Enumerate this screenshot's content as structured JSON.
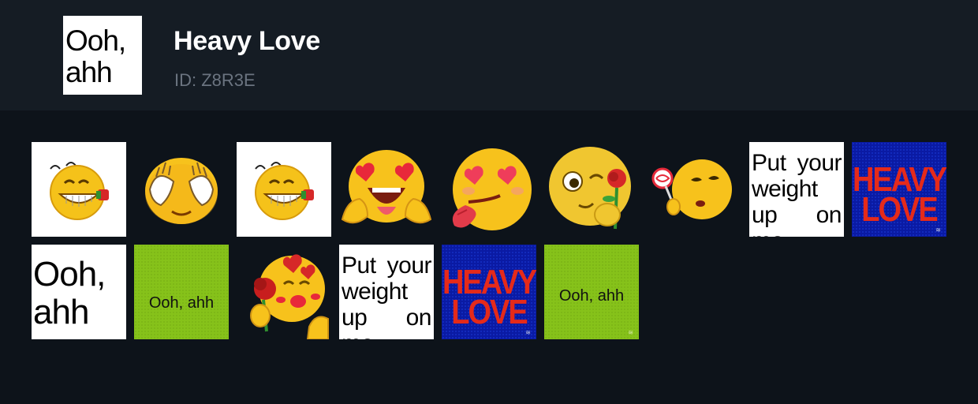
{
  "pack": {
    "title": "Heavy Love",
    "id_text": "ID: Z8R3E",
    "cover_text": "Ooh, ahh"
  },
  "stickers": [
    {
      "kind": "emoji",
      "art": "grin-holding-rose"
    },
    {
      "kind": "emoji",
      "art": "face-covering-eyes-hands"
    },
    {
      "kind": "emoji",
      "art": "grin-holding-rose"
    },
    {
      "kind": "emoji",
      "art": "heart-eyes-tongue-hands"
    },
    {
      "kind": "emoji",
      "art": "heart-eyes-tongue-out"
    },
    {
      "kind": "emoji",
      "art": "wink-holding-rose"
    },
    {
      "kind": "emoji",
      "art": "lollipop-face"
    },
    {
      "kind": "text",
      "text": "Put your weight up on me"
    },
    {
      "kind": "poster",
      "line1": "HEAVY",
      "line2": "LOVE"
    },
    {
      "kind": "text-big",
      "text": "Ooh, ahh"
    },
    {
      "kind": "green",
      "text": "Ooh, ahh"
    },
    {
      "kind": "emoji",
      "art": "kissing-face-with-rose"
    },
    {
      "kind": "text",
      "text": "Put your weight up on me"
    },
    {
      "kind": "poster",
      "line1": "HEAVY",
      "line2": "LOVE"
    },
    {
      "kind": "green",
      "text": "Ooh, ahh"
    }
  ],
  "colors": {
    "page_background": "#0d131a",
    "header_background": "#151c24",
    "title": "#ffffff",
    "id_text": "#6b7480",
    "emoji_yellow": "#f7c21c",
    "poster_blue": "#0a1aa3",
    "poster_red": "#e52a1a",
    "green_card": "#86c21a"
  }
}
